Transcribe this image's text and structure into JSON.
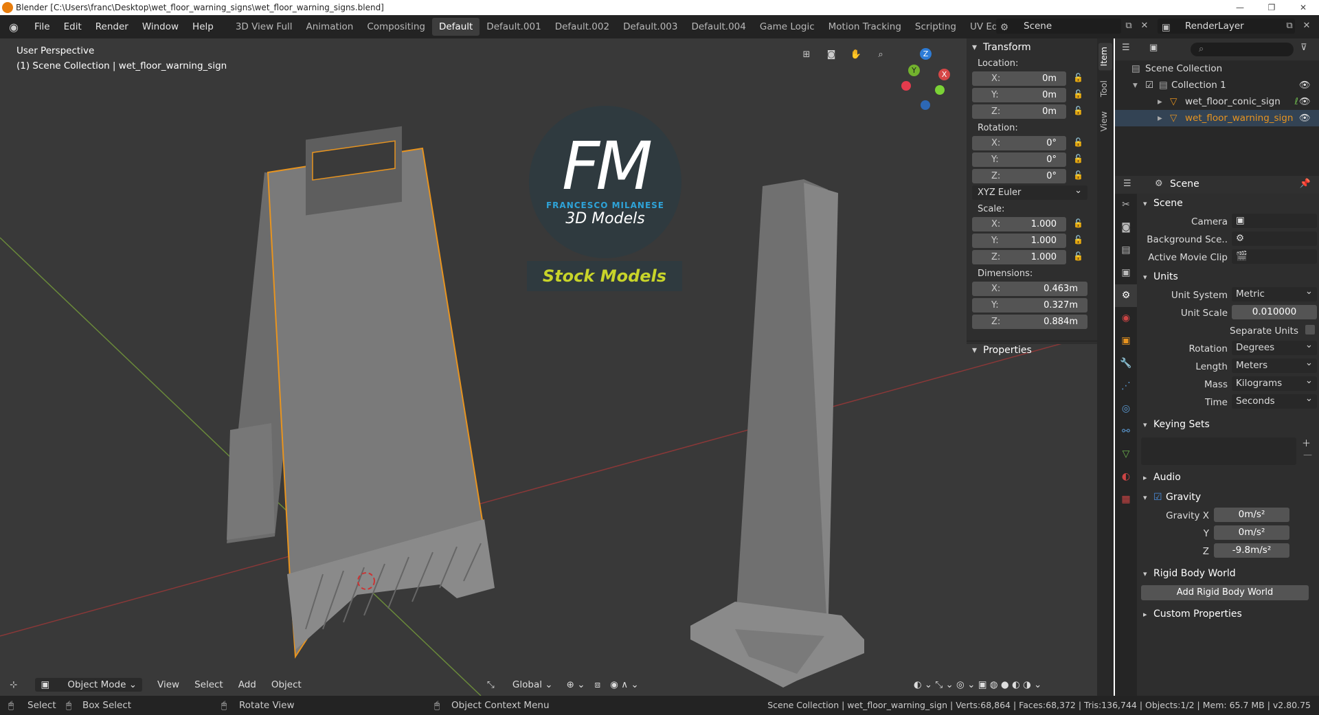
{
  "window": {
    "title": "Blender [C:\\Users\\franc\\Desktop\\wet_floor_warning_signs\\wet_floor_warning_signs.blend]"
  },
  "menu": [
    "File",
    "Edit",
    "Render",
    "Window",
    "Help"
  ],
  "workspaces": [
    "3D View Full",
    "Animation",
    "Compositing",
    "Default",
    "Default.001",
    "Default.002",
    "Default.003",
    "Default.004",
    "Game Logic",
    "Motion Tracking",
    "Scripting",
    "UV Editing"
  ],
  "active_workspace": "Default",
  "scene_name": "Scene",
  "render_layer": "RenderLayer",
  "viewport": {
    "perspective": "User Perspective",
    "collection_info": "(1) Scene Collection | wet_floor_warning_sign",
    "mode": "Object Mode",
    "menus": [
      "View",
      "Select",
      "Add",
      "Object"
    ],
    "orientation": "Global",
    "logo_initials": "FM",
    "logo_name": "FRANCESCO MILANESE",
    "logo_sub": "3D Models",
    "logo_banner": "Stock Models",
    "accent_orange": "#e8941f",
    "gizmo": {
      "x": "X",
      "y": "Y",
      "z": "Z"
    }
  },
  "transform": {
    "title": "Transform",
    "location_label": "Location:",
    "location": [
      {
        "axis": "X:",
        "val": "0m"
      },
      {
        "axis": "Y:",
        "val": "0m"
      },
      {
        "axis": "Z:",
        "val": "0m"
      }
    ],
    "rotation_label": "Rotation:",
    "rotation": [
      {
        "axis": "X:",
        "val": "0°"
      },
      {
        "axis": "Y:",
        "val": "0°"
      },
      {
        "axis": "Z:",
        "val": "0°"
      }
    ],
    "rotation_mode": "XYZ Euler",
    "scale_label": "Scale:",
    "scale": [
      {
        "axis": "X:",
        "val": "1.000"
      },
      {
        "axis": "Y:",
        "val": "1.000"
      },
      {
        "axis": "Z:",
        "val": "1.000"
      }
    ],
    "dimensions_label": "Dimensions:",
    "dimensions": [
      {
        "axis": "X:",
        "val": "0.463m"
      },
      {
        "axis": "Y:",
        "val": "0.327m"
      },
      {
        "axis": "Z:",
        "val": "0.884m"
      }
    ],
    "properties": "Properties"
  },
  "side_tabs": [
    "Item",
    "Tool",
    "View"
  ],
  "outliner": {
    "search_placeholder": "",
    "items": [
      {
        "label": "Scene Collection"
      },
      {
        "label": "Collection 1"
      },
      {
        "label": "wet_floor_conic_sign"
      },
      {
        "label": "wet_floor_warning_sign"
      }
    ]
  },
  "properties": {
    "header": "Scene",
    "scene_section": "Scene",
    "camera_label": "Camera",
    "bg_scene_label": "Background Sce..",
    "movie_clip_label": "Active Movie Clip",
    "units_section": "Units",
    "unit_system_label": "Unit System",
    "unit_system": "Metric",
    "unit_scale_label": "Unit Scale",
    "unit_scale": "0.010000",
    "separate_units": "Separate Units",
    "rotation_label": "Rotation",
    "rotation": "Degrees",
    "length_label": "Length",
    "length": "Meters",
    "mass_label": "Mass",
    "mass": "Kilograms",
    "time_label": "Time",
    "time": "Seconds",
    "keying_sets": "Keying Sets",
    "audio": "Audio",
    "gravity": "Gravity",
    "gravity_x_label": "Gravity X",
    "gravity_y_label": "Y",
    "gravity_z_label": "Z",
    "gravity_x": "0m/s²",
    "gravity_y": "0m/s²",
    "gravity_z": "-9.8m/s²",
    "rigid_body": "Rigid Body World",
    "add_rigid": "Add Rigid Body World",
    "custom_props": "Custom Properties"
  },
  "status": {
    "select": "Select",
    "box_select": "Box Select",
    "rotate": "Rotate View",
    "context": "Object Context Menu",
    "stats": "Scene Collection | wet_floor_warning_sign | Verts:68,864 | Faces:68,372 | Tris:136,744 | Objects:1/2 | Mem: 65.7 MB | v2.80.75"
  }
}
